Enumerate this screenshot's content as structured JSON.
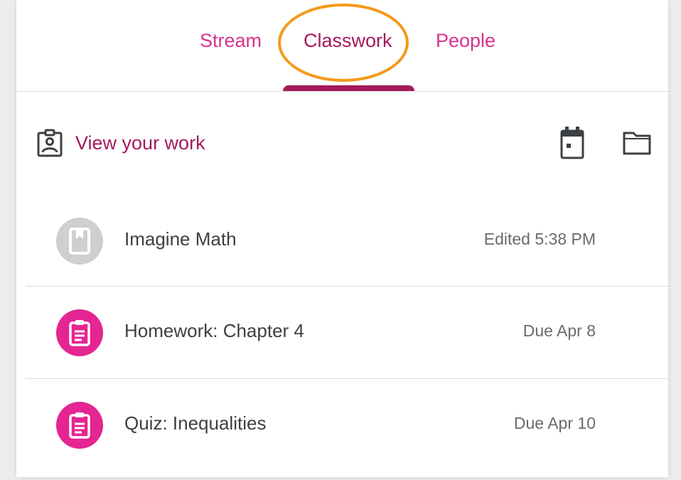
{
  "tabs": [
    {
      "label": "Stream",
      "active": false
    },
    {
      "label": "Classwork",
      "active": true
    },
    {
      "label": "People",
      "active": false
    }
  ],
  "toolbar": {
    "view_your_work": "View your work",
    "icons": [
      "assignment-ind-icon",
      "calendar-icon",
      "folder-icon"
    ]
  },
  "items": [
    {
      "title": "Imagine Math",
      "meta": "Edited 5:38 PM",
      "icon": "material-icon",
      "icon_color": "#cfcfcf"
    },
    {
      "title": "Homework: Chapter 4",
      "meta": "Due Apr 8",
      "icon": "assignment-icon",
      "icon_color": "#e52592"
    },
    {
      "title": "Quiz: Inequalities",
      "meta": "Due Apr 10",
      "icon": "assignment-icon",
      "icon_color": "#e52592"
    }
  ],
  "colors": {
    "accent": "#a3195b",
    "tab_text": "#d6338f",
    "assignment_circle": "#e52592",
    "material_circle": "#cfcfcf",
    "highlight": "#f39a1a"
  }
}
